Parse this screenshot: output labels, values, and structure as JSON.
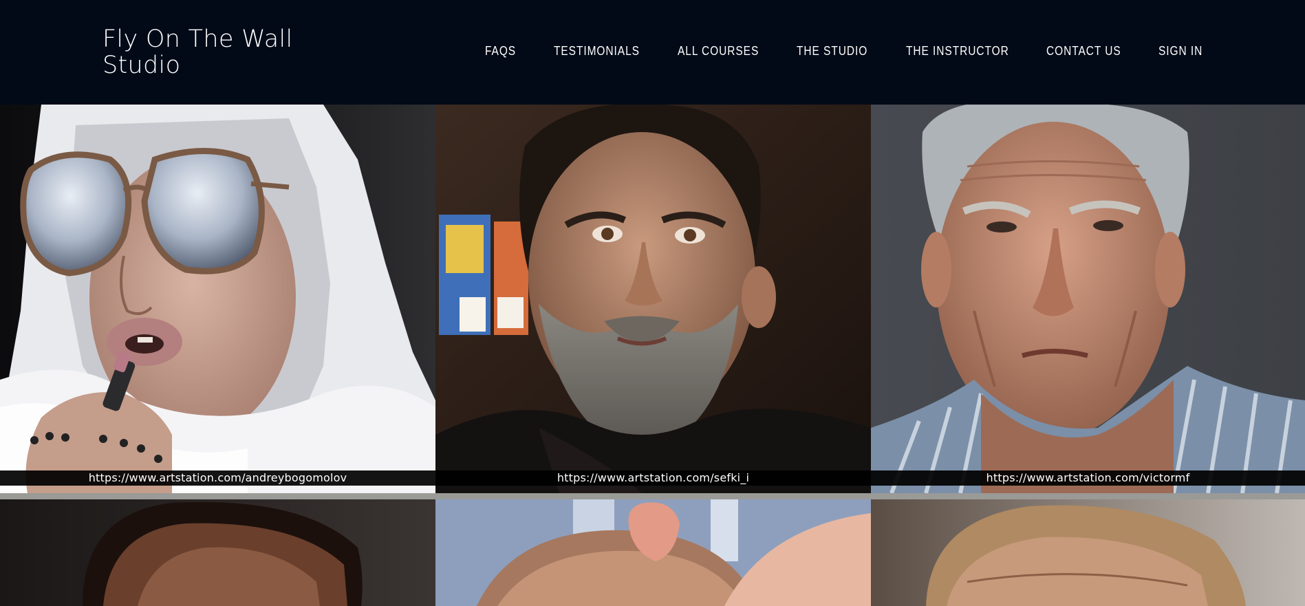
{
  "header": {
    "logo_text": "Fly On The Wall Studio"
  },
  "nav": {
    "items": [
      {
        "label": "FAQS"
      },
      {
        "label": "TESTIMONIALS"
      },
      {
        "label": "ALL COURSES"
      },
      {
        "label": "THE STUDIO"
      },
      {
        "label": "THE INSTRUCTOR"
      },
      {
        "label": "CONTACT US"
      },
      {
        "label": "SIGN IN"
      }
    ]
  },
  "gallery": {
    "tiles": [
      {
        "caption": "https://www.artstation.com/andreybogomolov"
      },
      {
        "caption": "https://www.artstation.com/sefki_i"
      },
      {
        "caption": "https://www.artstation.com/victormf"
      }
    ]
  },
  "colors": {
    "header_bg": "#020a17",
    "nav_text": "#ffffff",
    "caption_bg": "#000000"
  }
}
